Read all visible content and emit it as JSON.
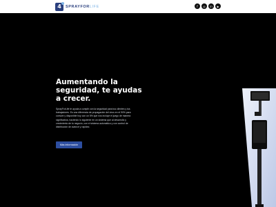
{
  "header": {
    "logo_mark": "4",
    "logo_brand": "SPRAYFOR",
    "logo_brand_light": "LIFE",
    "social": [
      {
        "icon": "facebook-icon",
        "glyph": "f"
      },
      {
        "icon": "instagram-icon",
        "glyph": "◎"
      },
      {
        "icon": "linkedin-icon",
        "glyph": "in"
      },
      {
        "icon": "youtube-icon",
        "glyph": "▶"
      }
    ]
  },
  "hero": {
    "title": "Aumentando la seguridad, te ayudas a crecer.",
    "body": "SprayForLife te ayuda a cumplir con la seguridad para tus clientes y tus trabajadores. Es una diferencia de propagación del virus en el 90% para convivir y disponible hoy con un 5% que nos incluye el juego de manera significativa, haciendo lo siguiente en un sistema que al desarrollo y crecimiento de tu negocio, con el sistema automático y con control de distribución de avance y rapidez.",
    "cta_label": "Más información"
  },
  "colors": {
    "brand": "#2a3f7e",
    "accent": "#7fb4e6",
    "cta": "#2d4ea0"
  }
}
